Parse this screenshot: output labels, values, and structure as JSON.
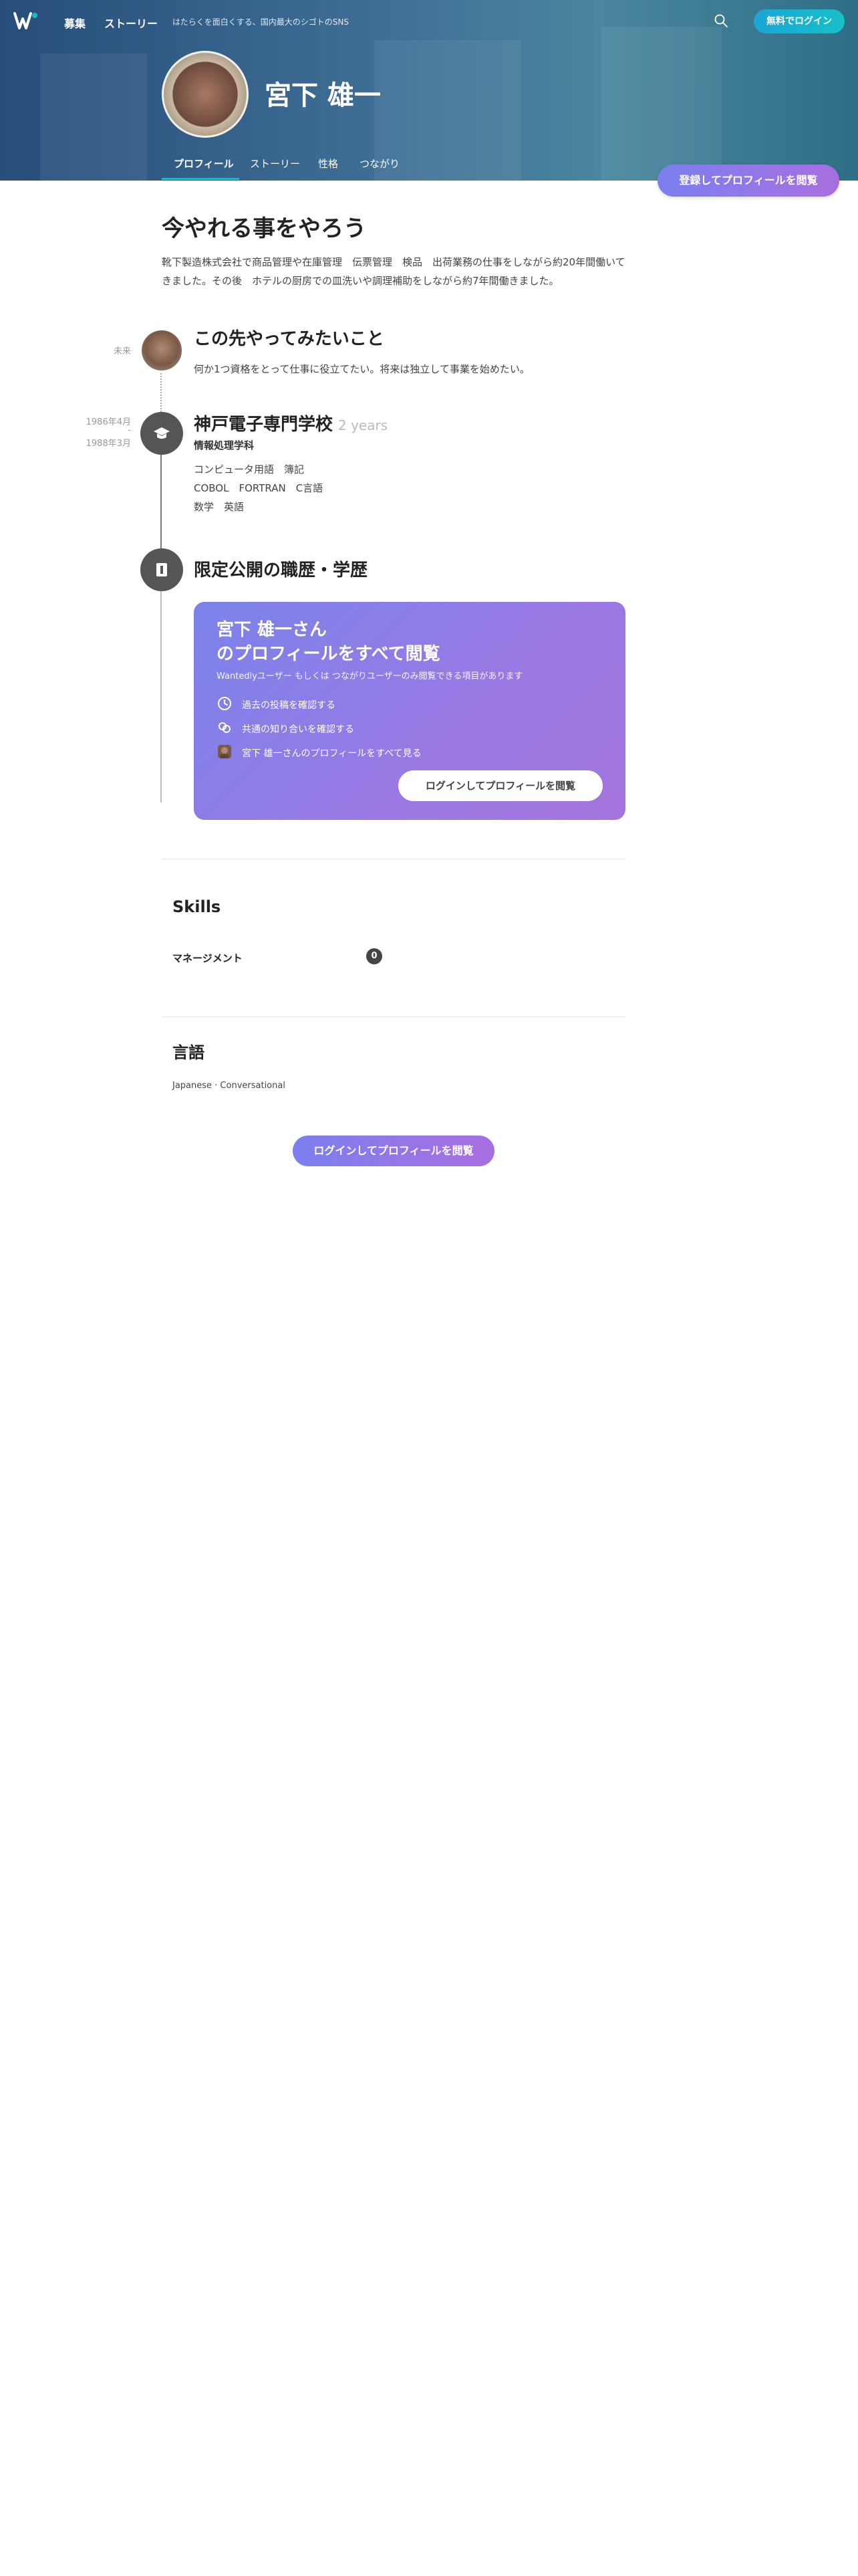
{
  "nav": {
    "links": [
      "募集",
      "ストーリー"
    ],
    "tagline": "はたらくを面白くする、国内最大のシゴトのSNS",
    "login_button": "無料でログイン"
  },
  "profile": {
    "name": "宮下 雄一",
    "tabs": [
      "プロフィール",
      "ストーリー",
      "性格",
      "つながり"
    ],
    "register_button": "登録してプロフィールを閲覧"
  },
  "headline": "今やれる事をやろう",
  "intro": "靴下製造株式会社で商品管理や在庫管理　伝票管理　検品　出荷業務の仕事をしながら約20年間働いてきました。その後　ホテルの厨房での皿洗いや調理補助をしながら約7年間働きました。",
  "timeline": {
    "future": {
      "label": "未来",
      "title": "この先やってみたいこと",
      "text": "何か1つ資格をとって仕事に役立てたい。将来は独立して事業を始めたい。"
    },
    "school": {
      "start": "1986年4月",
      "end": "1988年3月",
      "title": "神戸電子専門学校",
      "duration": "2 years",
      "dept": "情報処理学科",
      "lines": [
        "コンピュータ用語　簿記",
        "COBOL　FORTRAN　C言語",
        "数学　英語"
      ]
    },
    "private": {
      "title": "限定公開の職歴・学歴"
    }
  },
  "gate_card": {
    "title_line1": "宮下 雄一さん",
    "title_line2": "のプロフィールをすべて閲覧",
    "subtitle": "Wantedlyユーザー もしくは つながりユーザーのみ閲覧できる項目があります",
    "items": [
      {
        "icon": "clock-icon",
        "text": "過去の投稿を確認する"
      },
      {
        "icon": "link-icon",
        "text": "共通の知り合いを確認する"
      },
      {
        "icon": "avatar-icon",
        "text": "宮下 雄一さんのプロフィールをすべて見る"
      }
    ],
    "button": "ログインしてプロフィールを閲覧"
  },
  "skills": {
    "heading": "Skills",
    "items": [
      {
        "name": "マネージメント",
        "count": "0"
      }
    ]
  },
  "languages": {
    "heading": "言語",
    "text": "Japanese · Conversational"
  },
  "bottom_button": "ログインしてプロフィールを閲覧",
  "colors": {
    "hero": "#3f6f96",
    "accent_teal": "#23b7c4",
    "cta_purple": "#8f77e8"
  }
}
